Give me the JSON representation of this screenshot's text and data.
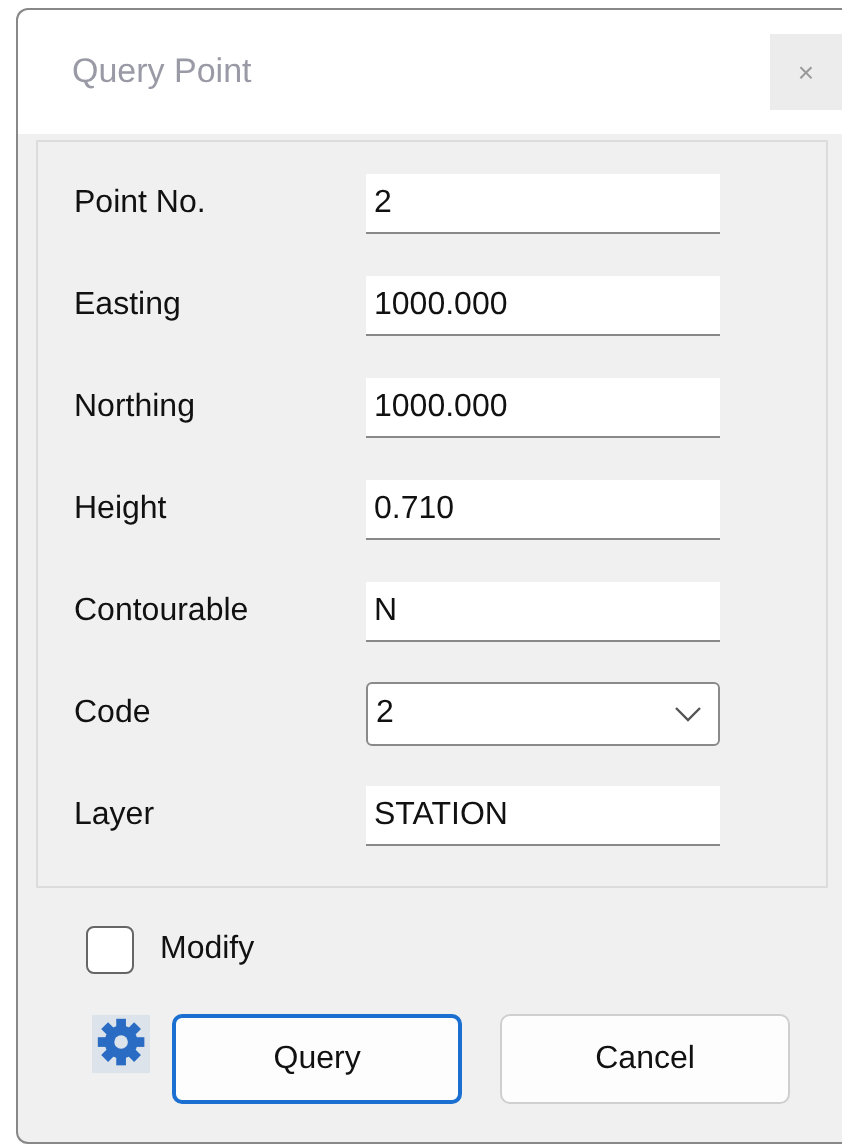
{
  "window": {
    "title": "Query Point",
    "close": "×"
  },
  "fields": [
    {
      "label": "Point No.",
      "value": "2",
      "kind": "text"
    },
    {
      "label": "Easting",
      "value": "1000.000",
      "kind": "text"
    },
    {
      "label": "Northing",
      "value": "1000.000",
      "kind": "text"
    },
    {
      "label": "Height",
      "value": "0.710",
      "kind": "text"
    },
    {
      "label": "Contourable",
      "value": "N",
      "kind": "text"
    },
    {
      "label": "Code",
      "value": "2",
      "kind": "combo"
    },
    {
      "label": "Layer",
      "value": "STATION",
      "kind": "text"
    }
  ],
  "modify": {
    "label": "Modify",
    "checked": false
  },
  "buttons": [
    {
      "label": "Query",
      "default": true
    },
    {
      "label": "Cancel",
      "default": false
    }
  ]
}
